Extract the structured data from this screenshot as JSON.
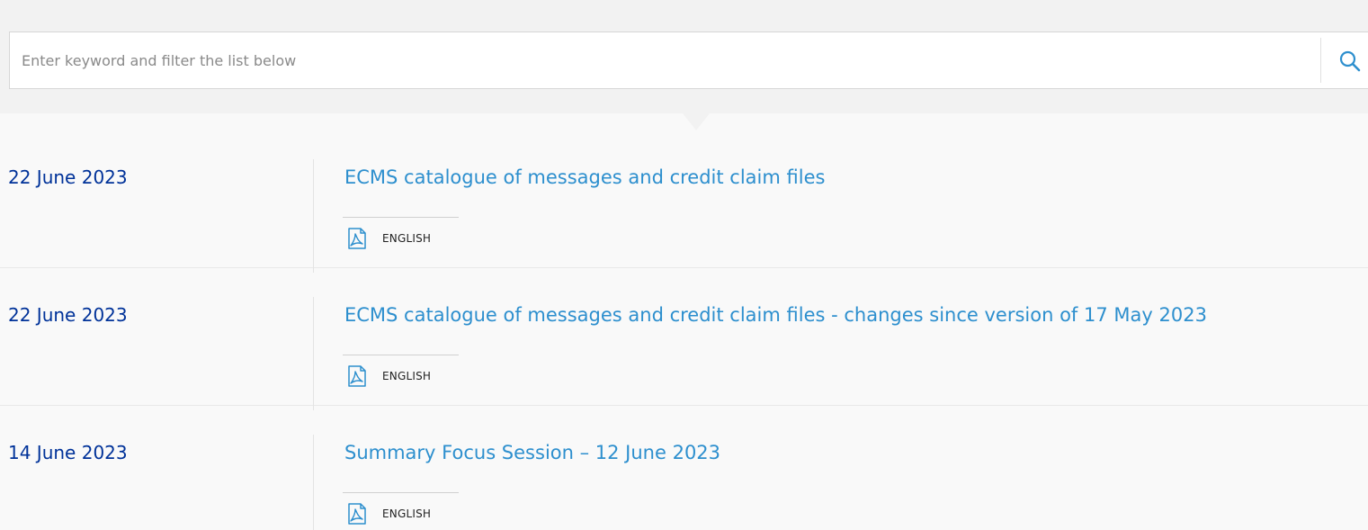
{
  "search": {
    "placeholder": "Enter keyword and filter the list below",
    "value": "",
    "icon": "search-icon"
  },
  "list": {
    "items": [
      {
        "date": "22 June 2023",
        "title": "ECMS catalogue of messages and credit claim files",
        "download": {
          "icon": "pdf-icon",
          "label": "ENGLISH"
        }
      },
      {
        "date": "22 June 2023",
        "title": "ECMS catalogue of messages and credit claim files - changes since version of 17 May 2023",
        "download": {
          "icon": "pdf-icon",
          "label": "ENGLISH"
        }
      },
      {
        "date": "14 June 2023",
        "title": "Summary Focus Session – 12 June 2023",
        "download": {
          "icon": "pdf-icon",
          "label": "ENGLISH"
        }
      }
    ]
  },
  "colors": {
    "date": "#003299",
    "link": "#2d8fce",
    "page_background": "#f2f2f2",
    "list_background": "#f9f9f9",
    "search_icon": "#2d8fce"
  }
}
